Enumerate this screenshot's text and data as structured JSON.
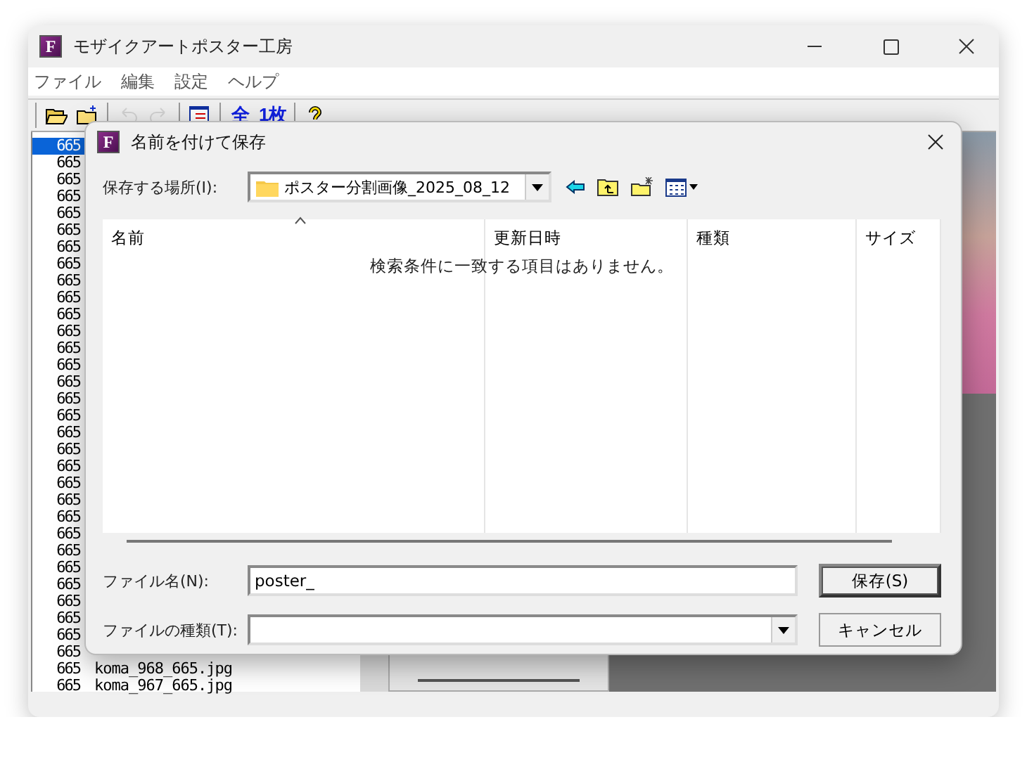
{
  "window": {
    "icon_letter": "F",
    "title": "モザイクアートポスター工房"
  },
  "menu": [
    "ファイル",
    "編集",
    "設定",
    "ヘルプ"
  ],
  "toolbar": [
    {
      "kind": "open",
      "disabled": false
    },
    {
      "kind": "newfolder",
      "disabled": false
    },
    {
      "kind": "undo",
      "disabled": true
    },
    {
      "kind": "redo",
      "disabled": true
    },
    {
      "kind": "list",
      "disabled": false
    },
    {
      "kind": "text",
      "label": "全",
      "disabled": false
    },
    {
      "kind": "text",
      "label": "1枚",
      "disabled": false
    },
    {
      "kind": "help",
      "disabled": false
    }
  ],
  "file_list": [
    {
      "number": "665",
      "selected": true
    },
    {
      "number": "665",
      "selected": false
    },
    {
      "number": "665",
      "selected": false
    },
    {
      "number": "665",
      "selected": false
    },
    {
      "number": "665",
      "selected": false
    },
    {
      "number": "665",
      "selected": false
    },
    {
      "number": "665",
      "selected": false
    },
    {
      "number": "665",
      "selected": false
    },
    {
      "number": "665",
      "selected": false
    },
    {
      "number": "665",
      "selected": false
    },
    {
      "number": "665",
      "selected": false
    },
    {
      "number": "665",
      "selected": false
    },
    {
      "number": "665",
      "selected": false
    },
    {
      "number": "665",
      "selected": false
    },
    {
      "number": "665",
      "selected": false
    },
    {
      "number": "665",
      "selected": false
    },
    {
      "number": "665",
      "selected": false
    },
    {
      "number": "665",
      "selected": false
    },
    {
      "number": "665",
      "selected": false
    },
    {
      "number": "665",
      "selected": false
    },
    {
      "number": "665",
      "selected": false
    },
    {
      "number": "665",
      "selected": false
    },
    {
      "number": "665",
      "selected": false
    },
    {
      "number": "665",
      "selected": false
    },
    {
      "number": "665",
      "selected": false
    },
    {
      "number": "665",
      "selected": false
    },
    {
      "number": "665",
      "selected": false
    },
    {
      "number": "665",
      "selected": false
    },
    {
      "number": "665",
      "selected": false
    },
    {
      "number": "665",
      "selected": false
    },
    {
      "number": "665",
      "selected": false
    },
    {
      "number": "665",
      "name": "koma_968_665.jpg",
      "selected": false
    },
    {
      "number": "665",
      "name": "koma_967_665.jpg",
      "selected": false
    }
  ],
  "dialog": {
    "icon_letter": "F",
    "title": "名前を付けて保存",
    "location_label": "保存する場所(I):",
    "location": "ポスター分割画像_2025_08_12",
    "columns": [
      {
        "label": "名前",
        "sorted": true
      },
      {
        "label": "更新日時",
        "sorted": false
      },
      {
        "label": "種類",
        "sorted": false
      },
      {
        "label": "サイズ",
        "sorted": false
      }
    ],
    "empty_message": "検索条件に一致する項目はありません。",
    "filename_label": "ファイル名(N):",
    "filename": "poster_",
    "filetype_label": "ファイルの種類(T):",
    "buttons": [
      {
        "label": "保存(S)",
        "kind": "default"
      },
      {
        "label": "キャンセル",
        "kind": "normal"
      }
    ]
  }
}
